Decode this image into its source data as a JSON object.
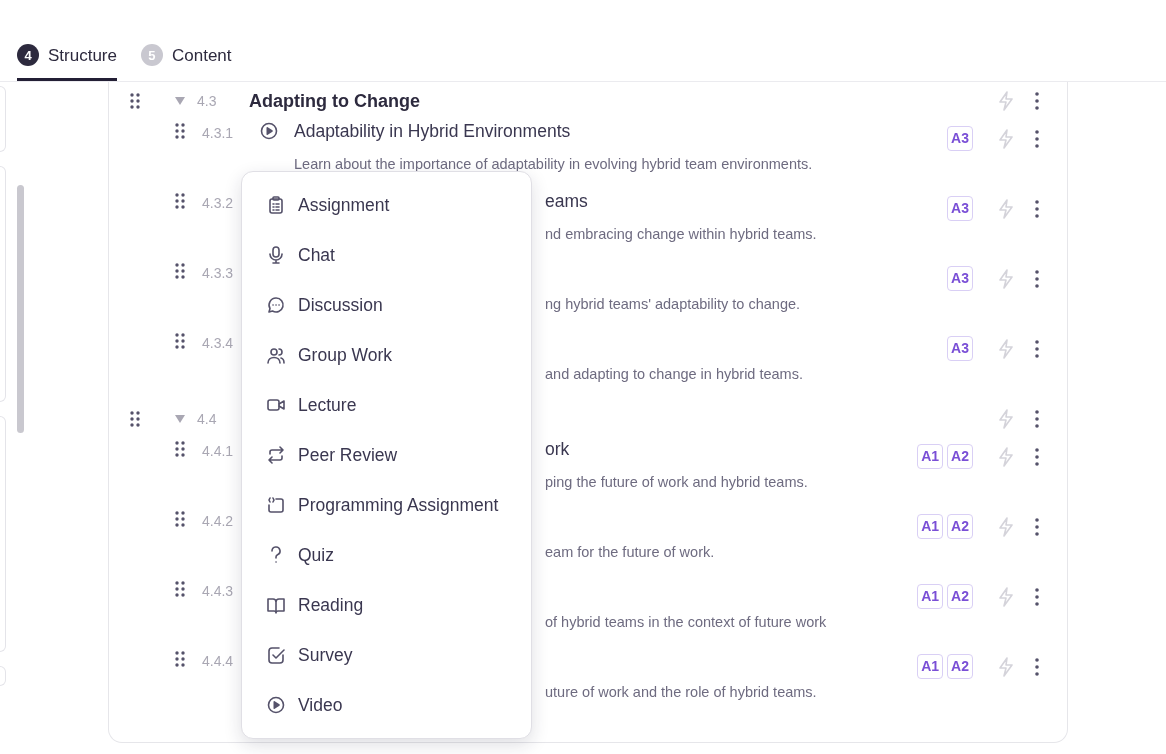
{
  "tabs": [
    {
      "number": "4",
      "label": "Structure",
      "selected": true
    },
    {
      "number": "5",
      "label": "Content",
      "selected": false
    }
  ],
  "sections": [
    {
      "number": "4.3",
      "title": "Adapting to Change",
      "expanded": true,
      "lessons": [
        {
          "number": "4.3.1",
          "kind": "video",
          "title": "Adaptability in Hybrid Environments",
          "description": "Learn about the importance of adaptability in evolving hybrid team environments.",
          "badges": [
            "A3"
          ]
        },
        {
          "number": "4.3.2",
          "kind": "covered",
          "title": "eams",
          "description": "nd embracing change within hybrid teams.",
          "badges": [
            "A3"
          ]
        },
        {
          "number": "4.3.3",
          "kind": "covered",
          "description": "ng hybrid teams' adaptability to change.",
          "badges": [
            "A3"
          ]
        },
        {
          "number": "4.3.4",
          "kind": "covered",
          "description": "and adapting to change in hybrid teams.",
          "badges": [
            "A3"
          ]
        }
      ]
    },
    {
      "number": "4.4",
      "expanded": true,
      "lessons": [
        {
          "number": "4.4.1",
          "kind": "covered",
          "title": "ork",
          "description": "ping the future of work and hybrid teams.",
          "badges": [
            "A1",
            "A2"
          ]
        },
        {
          "number": "4.4.2",
          "kind": "covered",
          "description": "eam for the future of work.",
          "badges": [
            "A1",
            "A2"
          ]
        },
        {
          "number": "4.4.3",
          "kind": "covered",
          "description": "of hybrid teams in the context of future work",
          "badges": [
            "A1",
            "A2"
          ]
        },
        {
          "number": "4.4.4",
          "kind": "covered",
          "description": "uture of work and the role of hybrid teams.",
          "badges": [
            "A1",
            "A2"
          ]
        }
      ]
    }
  ],
  "menu": {
    "items": [
      {
        "kind": "assignment",
        "label": "Assignment"
      },
      {
        "kind": "chat",
        "label": "Chat"
      },
      {
        "kind": "discussion",
        "label": "Discussion"
      },
      {
        "kind": "group",
        "label": "Group Work"
      },
      {
        "kind": "lecture",
        "label": "Lecture"
      },
      {
        "kind": "review",
        "label": "Peer Review"
      },
      {
        "kind": "programming",
        "label": "Programming Assignment"
      },
      {
        "kind": "quiz",
        "label": "Quiz"
      },
      {
        "kind": "reading",
        "label": "Reading"
      },
      {
        "kind": "survey",
        "label": "Survey"
      },
      {
        "kind": "video",
        "label": "Video"
      }
    ]
  }
}
